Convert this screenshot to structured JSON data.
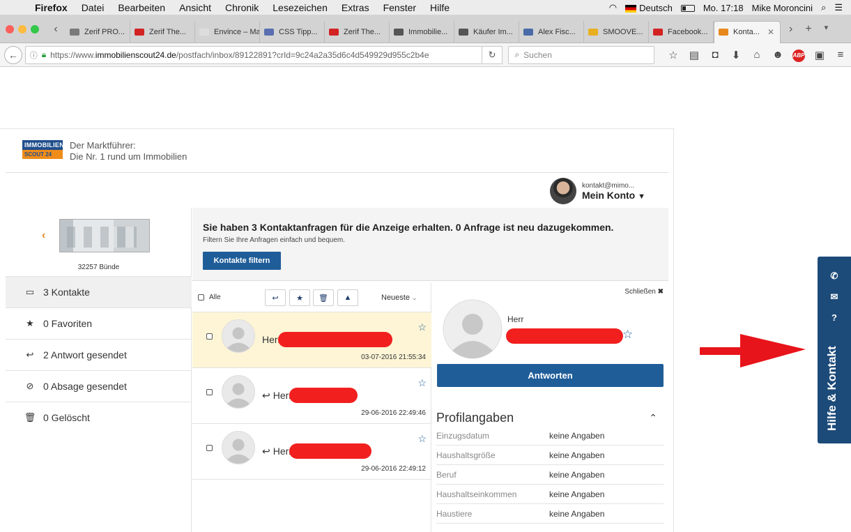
{
  "os_menu": {
    "app": "Firefox",
    "items": [
      "Datei",
      "Bearbeiten",
      "Ansicht",
      "Chronik",
      "Lesezeichen",
      "Extras",
      "Fenster",
      "Hilfe"
    ],
    "language": "Deutsch",
    "clock": "Mo. 17:18",
    "user": "Mike Moroncini"
  },
  "tabs": [
    {
      "label": "Zerif PRO...",
      "color": "#7a7a7a"
    },
    {
      "label": "Zerif The...",
      "color": "#d32222"
    },
    {
      "label": "Envince – Ma...",
      "color": "#dddddd"
    },
    {
      "label": "CSS Tipp...",
      "color": "#5a6fb0"
    },
    {
      "label": "Zerif The...",
      "color": "#d32222"
    },
    {
      "label": "Immobilie...",
      "color": "#555555"
    },
    {
      "label": "Käufer Im...",
      "color": "#555555"
    },
    {
      "label": "Alex Fisc...",
      "color": "#4a6aa8"
    },
    {
      "label": "SMOOVE...",
      "color": "#e8b020"
    },
    {
      "label": "Facebook...",
      "color": "#d32222"
    },
    {
      "label": "Konta...",
      "color": "#e8891e"
    }
  ],
  "url": {
    "prefix": "https://www.",
    "domain": "immobilienscout24.de",
    "path": "/postfach/inbox/89122891?crId=9c24a2a35d6c4d549929d955c2b4e",
    "search_placeholder": "Suchen"
  },
  "brand": {
    "logo_top": "IMMOBILIEN",
    "logo_bottom": "SCOUT 24",
    "tagline_1": "Der Marktführer:",
    "tagline_2": "Die Nr. 1 rund um Immobilien"
  },
  "account": {
    "email": "kontakt@mimo...",
    "label": "Mein Konto"
  },
  "listing": {
    "postcode_city": "32257 Bünde"
  },
  "sidebar": [
    {
      "label": "3 Kontakte",
      "icon": "inbox-icon",
      "glyph": "▭"
    },
    {
      "label": "0 Favoriten",
      "icon": "star-icon",
      "glyph": "★"
    },
    {
      "label": "2 Antwort gesendet",
      "icon": "reply-icon",
      "glyph": "↩"
    },
    {
      "label": "0 Absage gesendet",
      "icon": "forbidden-icon",
      "glyph": "⊘"
    },
    {
      "label": "0 Gelöscht",
      "icon": "trash-icon",
      "glyph": "🗑"
    }
  ],
  "banner": {
    "heading": "Sie haben 3 Kontaktanfragen für die Anzeige erhalten. 0 Anfrage ist neu dazugekommen.",
    "sub": "Filtern Sie Ihre Anfragen einfach und bequem.",
    "button": "Kontakte filtern"
  },
  "toolbar": {
    "select_all": "Alle",
    "sort": "Neueste"
  },
  "messages": [
    {
      "title": "Herr",
      "date": "03-07-2016 21:55:34",
      "replied": false,
      "selected": true
    },
    {
      "title": "Herr",
      "date": "29-06-2016 22:49:46",
      "replied": true,
      "selected": false
    },
    {
      "title": "Herr",
      "date": "29-06-2016 22:49:12",
      "replied": true,
      "selected": false
    }
  ],
  "detail": {
    "close": "Schließen",
    "salutation": "Herr",
    "reply_button": "Antworten",
    "profile_title": "Profilangaben",
    "profile": [
      {
        "key": "Einzugsdatum",
        "value": "keine Angaben"
      },
      {
        "key": "Haushaltsgröße",
        "value": "keine Angaben"
      },
      {
        "key": "Beruf",
        "value": "keine Angaben"
      },
      {
        "key": "Haushaltseinkommen",
        "value": "keine Angaben"
      },
      {
        "key": "Haustiere",
        "value": "keine Angaben"
      }
    ]
  },
  "help_tab": {
    "label": "Hilfe & Kontakt"
  },
  "colors": {
    "brand_blue": "#1f5d99",
    "help_blue": "#1c4a79",
    "accent_orange": "#e8891e",
    "redaction": "#f21f1f",
    "selected_row": "#fdf5d6"
  }
}
